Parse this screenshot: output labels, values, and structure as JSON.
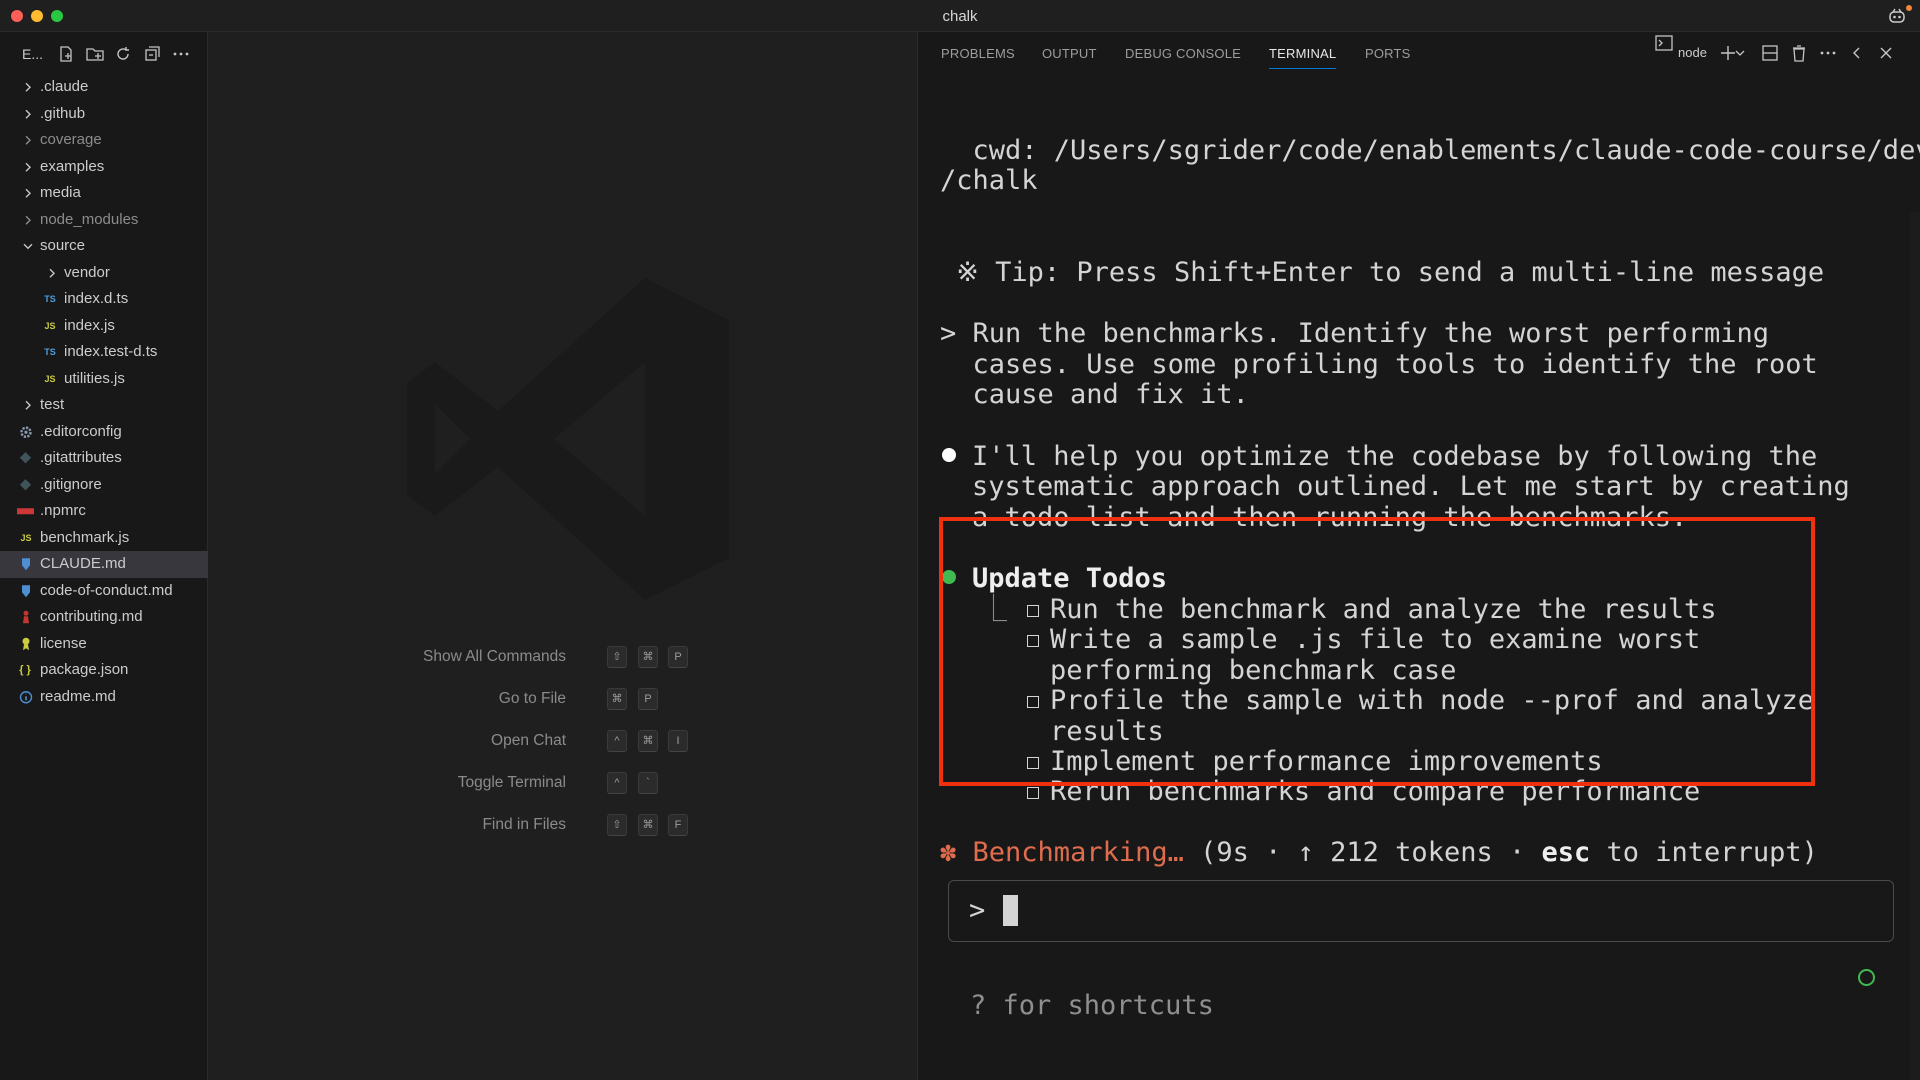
{
  "window": {
    "title": "chalk"
  },
  "sidebar": {
    "title": "E...",
    "items": [
      {
        "label": ".claude",
        "kind": "folder",
        "open": false
      },
      {
        "label": ".github",
        "kind": "folder",
        "open": false
      },
      {
        "label": "coverage",
        "kind": "folder",
        "open": false
      },
      {
        "label": "examples",
        "kind": "folder",
        "open": false
      },
      {
        "label": "media",
        "kind": "folder",
        "open": false
      },
      {
        "label": "node_modules",
        "kind": "folder",
        "open": false
      },
      {
        "label": "source",
        "kind": "folder",
        "open": true
      },
      {
        "label": "vendor",
        "kind": "folder",
        "open": false
      },
      {
        "label": "index.d.ts",
        "kind": "file",
        "icon": "TS"
      },
      {
        "label": "index.js",
        "kind": "file",
        "icon": "JS"
      },
      {
        "label": "index.test-d.ts",
        "kind": "file",
        "icon": "TS"
      },
      {
        "label": "utilities.js",
        "kind": "file",
        "icon": "JS"
      },
      {
        "label": "test",
        "kind": "folder",
        "open": false
      },
      {
        "label": ".editorconfig",
        "kind": "file",
        "icon": "gear-icon"
      },
      {
        "label": ".gitattributes",
        "kind": "file",
        "icon": "git-icon"
      },
      {
        "label": ".gitignore",
        "kind": "file",
        "icon": "git-icon"
      },
      {
        "label": ".npmrc",
        "kind": "file",
        "icon": "npm-icon"
      },
      {
        "label": "benchmark.js",
        "kind": "file",
        "icon": "JS"
      },
      {
        "label": "CLAUDE.md",
        "kind": "file",
        "icon": "markdown-icon"
      },
      {
        "label": "code-of-conduct.md",
        "kind": "file",
        "icon": "markdown-icon"
      },
      {
        "label": "contributing.md",
        "kind": "file",
        "icon": "person-icon"
      },
      {
        "label": "license",
        "kind": "file",
        "icon": "license-icon"
      },
      {
        "label": "package.json",
        "kind": "file",
        "icon": "{ }"
      },
      {
        "label": "readme.md",
        "kind": "file",
        "icon": "info-icon"
      }
    ]
  },
  "editor": {
    "commands": [
      {
        "label": "Show All Commands",
        "keys": [
          "⇧",
          "⌘",
          "P"
        ]
      },
      {
        "label": "Go to File",
        "keys": [
          "⌘",
          "P"
        ]
      },
      {
        "label": "Open Chat",
        "keys": [
          "^",
          "⌘",
          "I"
        ]
      },
      {
        "label": "Toggle Terminal",
        "keys": [
          "^",
          "`"
        ]
      },
      {
        "label": "Find in Files",
        "keys": [
          "⇧",
          "⌘",
          "F"
        ]
      }
    ]
  },
  "panel": {
    "tabs": [
      "PROBLEMS",
      "OUTPUT",
      "DEBUG CONSOLE",
      "TERMINAL",
      "PORTS"
    ],
    "active_tab": "TERMINAL",
    "terminal_name": "node"
  },
  "terminal": {
    "cwd_line1": "  cwd: /Users/sgrider/code/enablements/claude-code-course/dev",
    "cwd_line2": "/chalk",
    "tip": " ※ Tip: Press Shift+Enter to send a multi-line message",
    "user_prompt": [
      "> Run the benchmarks. Identify the worst performing",
      "  cases. Use some profiling tools to identify the root",
      "  cause and fix it."
    ],
    "assistant_message": [
      "I'll help you optimize the codebase by following the",
      "systematic approach outlined. Let me start by creating",
      "a todo list and then running the benchmarks."
    ],
    "todos_title": "Update Todos",
    "tree_glyph": "⎿",
    "todos": [
      [
        "Run the benchmark and analyze the results"
      ],
      [
        "Write a sample .js file to examine worst",
        "performing benchmark case"
      ],
      [
        "Profile the sample with node --prof and analyze",
        "results"
      ],
      [
        "Implement performance improvements"
      ],
      [
        "Rerun benchmarks and compare performance"
      ]
    ],
    "status": {
      "glyph": "✽",
      "label": "Benchmarking…",
      "open": " (9s · ↑ 212 tokens · ",
      "esc": "esc",
      "close": " to interrupt)"
    },
    "input_prompt": ">",
    "hint": "? for shortcuts"
  },
  "colors": {
    "accent": "#0078d4",
    "highlight_border": "#f0310f",
    "status_orange": "#e06c4e",
    "todo_dot_green": "#3fb950"
  }
}
